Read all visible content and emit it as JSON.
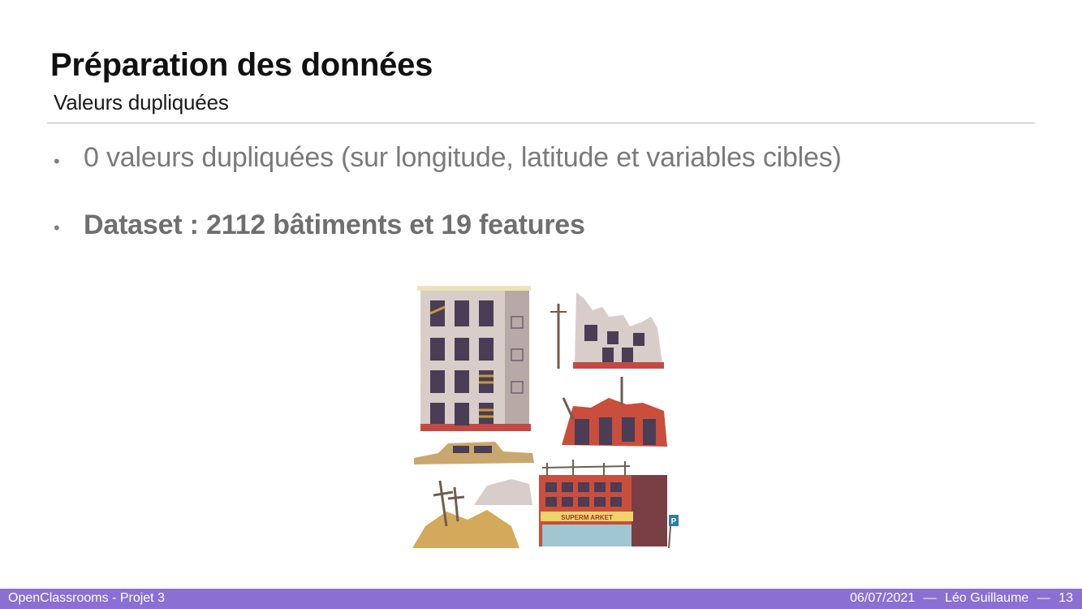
{
  "slide": {
    "title": "Préparation des données",
    "subtitle": "Valeurs dupliquées",
    "bullets": [
      {
        "marker": "•",
        "text": "0 valeurs dupliquées (sur longitude, latitude et variables cibles)"
      },
      {
        "marker": "•",
        "text": "Dataset : 2112 bâtiments et 19 features"
      }
    ],
    "illustration": {
      "icon": "ruined-buildings-illustration",
      "shop_sign": "SUPERM ARKET",
      "parking_sign": "P"
    }
  },
  "footer": {
    "left": "OpenClassrooms - Projet 3",
    "date": "06/07/2021",
    "sep1": "—",
    "author": "Léo Guillaume",
    "sep2": "—",
    "page": "13",
    "bar_color": "#8b6fd3"
  }
}
